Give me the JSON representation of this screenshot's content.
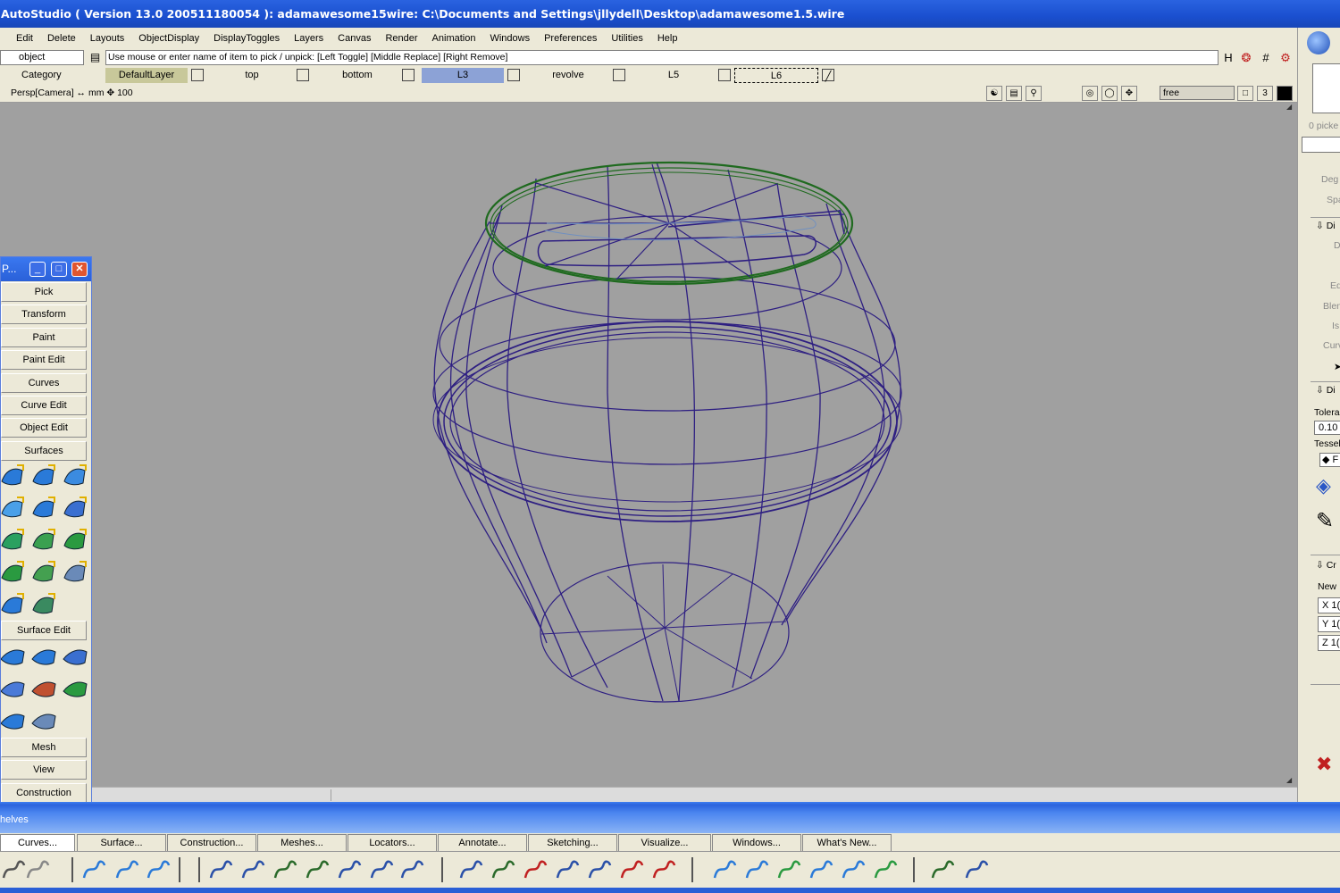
{
  "window": {
    "title": "AutoStudio ( Version 13.0  200511180054 ): adamawesome15wire: C:\\Documents and Settings\\jllydell\\Desktop\\adamawesome1.5.wire"
  },
  "menu": [
    "Edit",
    "Delete",
    "Layouts",
    "ObjectDisplay",
    "DisplayToggles",
    "Layers",
    "Canvas",
    "Render",
    "Animation",
    "Windows",
    "Preferences",
    "Utilities",
    "Help"
  ],
  "toolbar": {
    "mode_value": "object",
    "prompt_text": "Use mouse or enter name of item to pick / unpick: [Left Toggle] [Middle Replace] [Right Remove]",
    "category_label": "Category",
    "icons": [
      "hotkey-icon",
      "pick-point-icon",
      "snap-grid-icon",
      "pick-locator-icon"
    ]
  },
  "layers": [
    {
      "name": "DefaultLayer",
      "color": "#c8c89a"
    },
    {
      "name": "top",
      "color": "#ece9d8"
    },
    {
      "name": "bottom",
      "color": "#ece9d8"
    },
    {
      "name": "L3",
      "color": "#8ca2d6"
    },
    {
      "name": "revolve",
      "color": "#ece9d8"
    },
    {
      "name": "L5",
      "color": "#ece9d8"
    },
    {
      "name": "L6",
      "color": "#ece9d8"
    }
  ],
  "viewbar": {
    "camera": "Persp[Camera]",
    "units": "↔ mm",
    "grid": "100",
    "free_label": "free",
    "window_number": "3"
  },
  "palette": {
    "title": "P...",
    "buttons_top": [
      "Pick",
      "Transform",
      "Paint",
      "Paint Edit",
      "Curves",
      "Curve Edit",
      "Object Edit"
    ],
    "surfaces_label": "Surfaces",
    "surface_edit_label": "Surface Edit",
    "buttons_bottom": [
      "Mesh",
      "View",
      "Construction",
      "Locators"
    ]
  },
  "shelf": {
    "label": "helves",
    "tabs": [
      "Curves...",
      "Surface...",
      "Construction...",
      "Meshes...",
      "Locators...",
      "Annotate...",
      "Sketching...",
      "Visualize...",
      "Windows...",
      "What's New..."
    ]
  },
  "right_panel": {
    "picked": "0 picke",
    "items": [
      "Deg",
      "Spa",
      "Di",
      "D",
      "Ed",
      "Blen",
      "Is",
      "Curv",
      "Di",
      "Tolera",
      "0.10",
      "Tessel",
      "F",
      "Cr",
      "New",
      "X 1(",
      "Y 1(",
      "Z 1("
    ]
  },
  "colors": {
    "viewport_bg": "#a0a0a0",
    "wire": "#2e1f82",
    "selected_wire": "#1f6a1f",
    "titlebar": "#1f52d0"
  }
}
